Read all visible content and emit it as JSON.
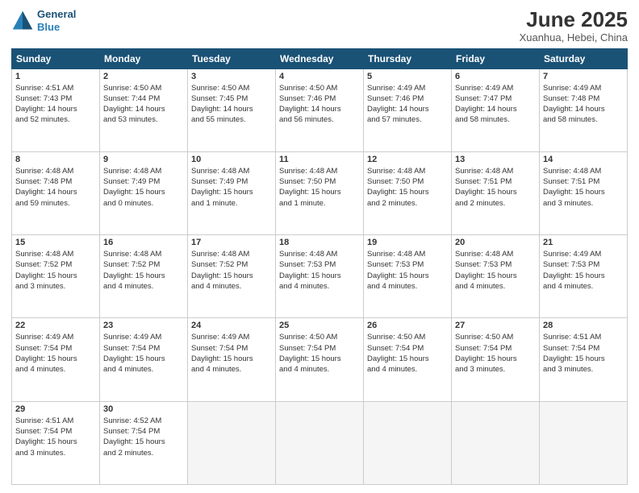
{
  "logo": {
    "line1": "General",
    "line2": "Blue"
  },
  "title": "June 2025",
  "subtitle": "Xuanhua, Hebei, China",
  "header_days": [
    "Sunday",
    "Monday",
    "Tuesday",
    "Wednesday",
    "Thursday",
    "Friday",
    "Saturday"
  ],
  "weeks": [
    [
      {
        "day": "1",
        "lines": [
          "Sunrise: 4:51 AM",
          "Sunset: 7:43 PM",
          "Daylight: 14 hours",
          "and 52 minutes."
        ]
      },
      {
        "day": "2",
        "lines": [
          "Sunrise: 4:50 AM",
          "Sunset: 7:44 PM",
          "Daylight: 14 hours",
          "and 53 minutes."
        ]
      },
      {
        "day": "3",
        "lines": [
          "Sunrise: 4:50 AM",
          "Sunset: 7:45 PM",
          "Daylight: 14 hours",
          "and 55 minutes."
        ]
      },
      {
        "day": "4",
        "lines": [
          "Sunrise: 4:50 AM",
          "Sunset: 7:46 PM",
          "Daylight: 14 hours",
          "and 56 minutes."
        ]
      },
      {
        "day": "5",
        "lines": [
          "Sunrise: 4:49 AM",
          "Sunset: 7:46 PM",
          "Daylight: 14 hours",
          "and 57 minutes."
        ]
      },
      {
        "day": "6",
        "lines": [
          "Sunrise: 4:49 AM",
          "Sunset: 7:47 PM",
          "Daylight: 14 hours",
          "and 58 minutes."
        ]
      },
      {
        "day": "7",
        "lines": [
          "Sunrise: 4:49 AM",
          "Sunset: 7:48 PM",
          "Daylight: 14 hours",
          "and 58 minutes."
        ]
      }
    ],
    [
      {
        "day": "8",
        "lines": [
          "Sunrise: 4:48 AM",
          "Sunset: 7:48 PM",
          "Daylight: 14 hours",
          "and 59 minutes."
        ]
      },
      {
        "day": "9",
        "lines": [
          "Sunrise: 4:48 AM",
          "Sunset: 7:49 PM",
          "Daylight: 15 hours",
          "and 0 minutes."
        ]
      },
      {
        "day": "10",
        "lines": [
          "Sunrise: 4:48 AM",
          "Sunset: 7:49 PM",
          "Daylight: 15 hours",
          "and 1 minute."
        ]
      },
      {
        "day": "11",
        "lines": [
          "Sunrise: 4:48 AM",
          "Sunset: 7:50 PM",
          "Daylight: 15 hours",
          "and 1 minute."
        ]
      },
      {
        "day": "12",
        "lines": [
          "Sunrise: 4:48 AM",
          "Sunset: 7:50 PM",
          "Daylight: 15 hours",
          "and 2 minutes."
        ]
      },
      {
        "day": "13",
        "lines": [
          "Sunrise: 4:48 AM",
          "Sunset: 7:51 PM",
          "Daylight: 15 hours",
          "and 2 minutes."
        ]
      },
      {
        "day": "14",
        "lines": [
          "Sunrise: 4:48 AM",
          "Sunset: 7:51 PM",
          "Daylight: 15 hours",
          "and 3 minutes."
        ]
      }
    ],
    [
      {
        "day": "15",
        "lines": [
          "Sunrise: 4:48 AM",
          "Sunset: 7:52 PM",
          "Daylight: 15 hours",
          "and 3 minutes."
        ]
      },
      {
        "day": "16",
        "lines": [
          "Sunrise: 4:48 AM",
          "Sunset: 7:52 PM",
          "Daylight: 15 hours",
          "and 4 minutes."
        ]
      },
      {
        "day": "17",
        "lines": [
          "Sunrise: 4:48 AM",
          "Sunset: 7:52 PM",
          "Daylight: 15 hours",
          "and 4 minutes."
        ]
      },
      {
        "day": "18",
        "lines": [
          "Sunrise: 4:48 AM",
          "Sunset: 7:53 PM",
          "Daylight: 15 hours",
          "and 4 minutes."
        ]
      },
      {
        "day": "19",
        "lines": [
          "Sunrise: 4:48 AM",
          "Sunset: 7:53 PM",
          "Daylight: 15 hours",
          "and 4 minutes."
        ]
      },
      {
        "day": "20",
        "lines": [
          "Sunrise: 4:48 AM",
          "Sunset: 7:53 PM",
          "Daylight: 15 hours",
          "and 4 minutes."
        ]
      },
      {
        "day": "21",
        "lines": [
          "Sunrise: 4:49 AM",
          "Sunset: 7:53 PM",
          "Daylight: 15 hours",
          "and 4 minutes."
        ]
      }
    ],
    [
      {
        "day": "22",
        "lines": [
          "Sunrise: 4:49 AM",
          "Sunset: 7:54 PM",
          "Daylight: 15 hours",
          "and 4 minutes."
        ]
      },
      {
        "day": "23",
        "lines": [
          "Sunrise: 4:49 AM",
          "Sunset: 7:54 PM",
          "Daylight: 15 hours",
          "and 4 minutes."
        ]
      },
      {
        "day": "24",
        "lines": [
          "Sunrise: 4:49 AM",
          "Sunset: 7:54 PM",
          "Daylight: 15 hours",
          "and 4 minutes."
        ]
      },
      {
        "day": "25",
        "lines": [
          "Sunrise: 4:50 AM",
          "Sunset: 7:54 PM",
          "Daylight: 15 hours",
          "and 4 minutes."
        ]
      },
      {
        "day": "26",
        "lines": [
          "Sunrise: 4:50 AM",
          "Sunset: 7:54 PM",
          "Daylight: 15 hours",
          "and 4 minutes."
        ]
      },
      {
        "day": "27",
        "lines": [
          "Sunrise: 4:50 AM",
          "Sunset: 7:54 PM",
          "Daylight: 15 hours",
          "and 3 minutes."
        ]
      },
      {
        "day": "28",
        "lines": [
          "Sunrise: 4:51 AM",
          "Sunset: 7:54 PM",
          "Daylight: 15 hours",
          "and 3 minutes."
        ]
      }
    ],
    [
      {
        "day": "29",
        "lines": [
          "Sunrise: 4:51 AM",
          "Sunset: 7:54 PM",
          "Daylight: 15 hours",
          "and 3 minutes."
        ]
      },
      {
        "day": "30",
        "lines": [
          "Sunrise: 4:52 AM",
          "Sunset: 7:54 PM",
          "Daylight: 15 hours",
          "and 2 minutes."
        ]
      },
      {
        "day": "",
        "lines": []
      },
      {
        "day": "",
        "lines": []
      },
      {
        "day": "",
        "lines": []
      },
      {
        "day": "",
        "lines": []
      },
      {
        "day": "",
        "lines": []
      }
    ]
  ]
}
